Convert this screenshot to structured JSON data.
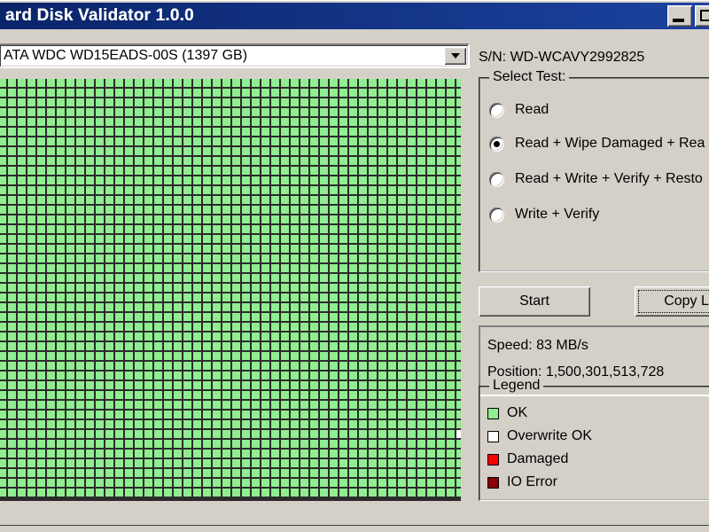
{
  "window": {
    "title": "ard Disk Validator 1.0.0",
    "minimize_icon": "minimize-icon",
    "maximize_icon": "maximize-icon"
  },
  "drive_select": {
    "value": "ATA WDC WD15EADS-00S (1397 GB)",
    "arrow_icon": "chevron-down-icon"
  },
  "serial": {
    "text": "S/N: WD-WCAVY2992825"
  },
  "select_test": {
    "title": "Select Test:",
    "options": [
      {
        "label": "Read",
        "checked": false
      },
      {
        "label": "Read + Wipe Damaged + Rea",
        "checked": true
      },
      {
        "label": "Read + Write + Verify + Resto",
        "checked": false
      },
      {
        "label": "Write + Verify",
        "checked": false
      }
    ]
  },
  "buttons": {
    "start": "Start",
    "copy_log": "Copy Lo"
  },
  "status": {
    "speed": "Speed: 83 MB/s",
    "position": "Position: 1,500,301,513,728"
  },
  "legend": {
    "title": "Legend",
    "items": [
      {
        "label": "OK",
        "color": "#90ee90"
      },
      {
        "label": "Overwrite OK",
        "color": "#ffffff"
      },
      {
        "label": "Damaged",
        "color": "#ff0000"
      },
      {
        "label": "IO Error",
        "color": "#8b0000"
      }
    ]
  },
  "disk_map": {
    "columns": 48,
    "rows": 43,
    "default_color": "#90ee90",
    "grid_line_color": "#2b2b2b",
    "special_cells": [
      {
        "col": 47,
        "row": 36,
        "color": "#ffffff"
      }
    ]
  }
}
